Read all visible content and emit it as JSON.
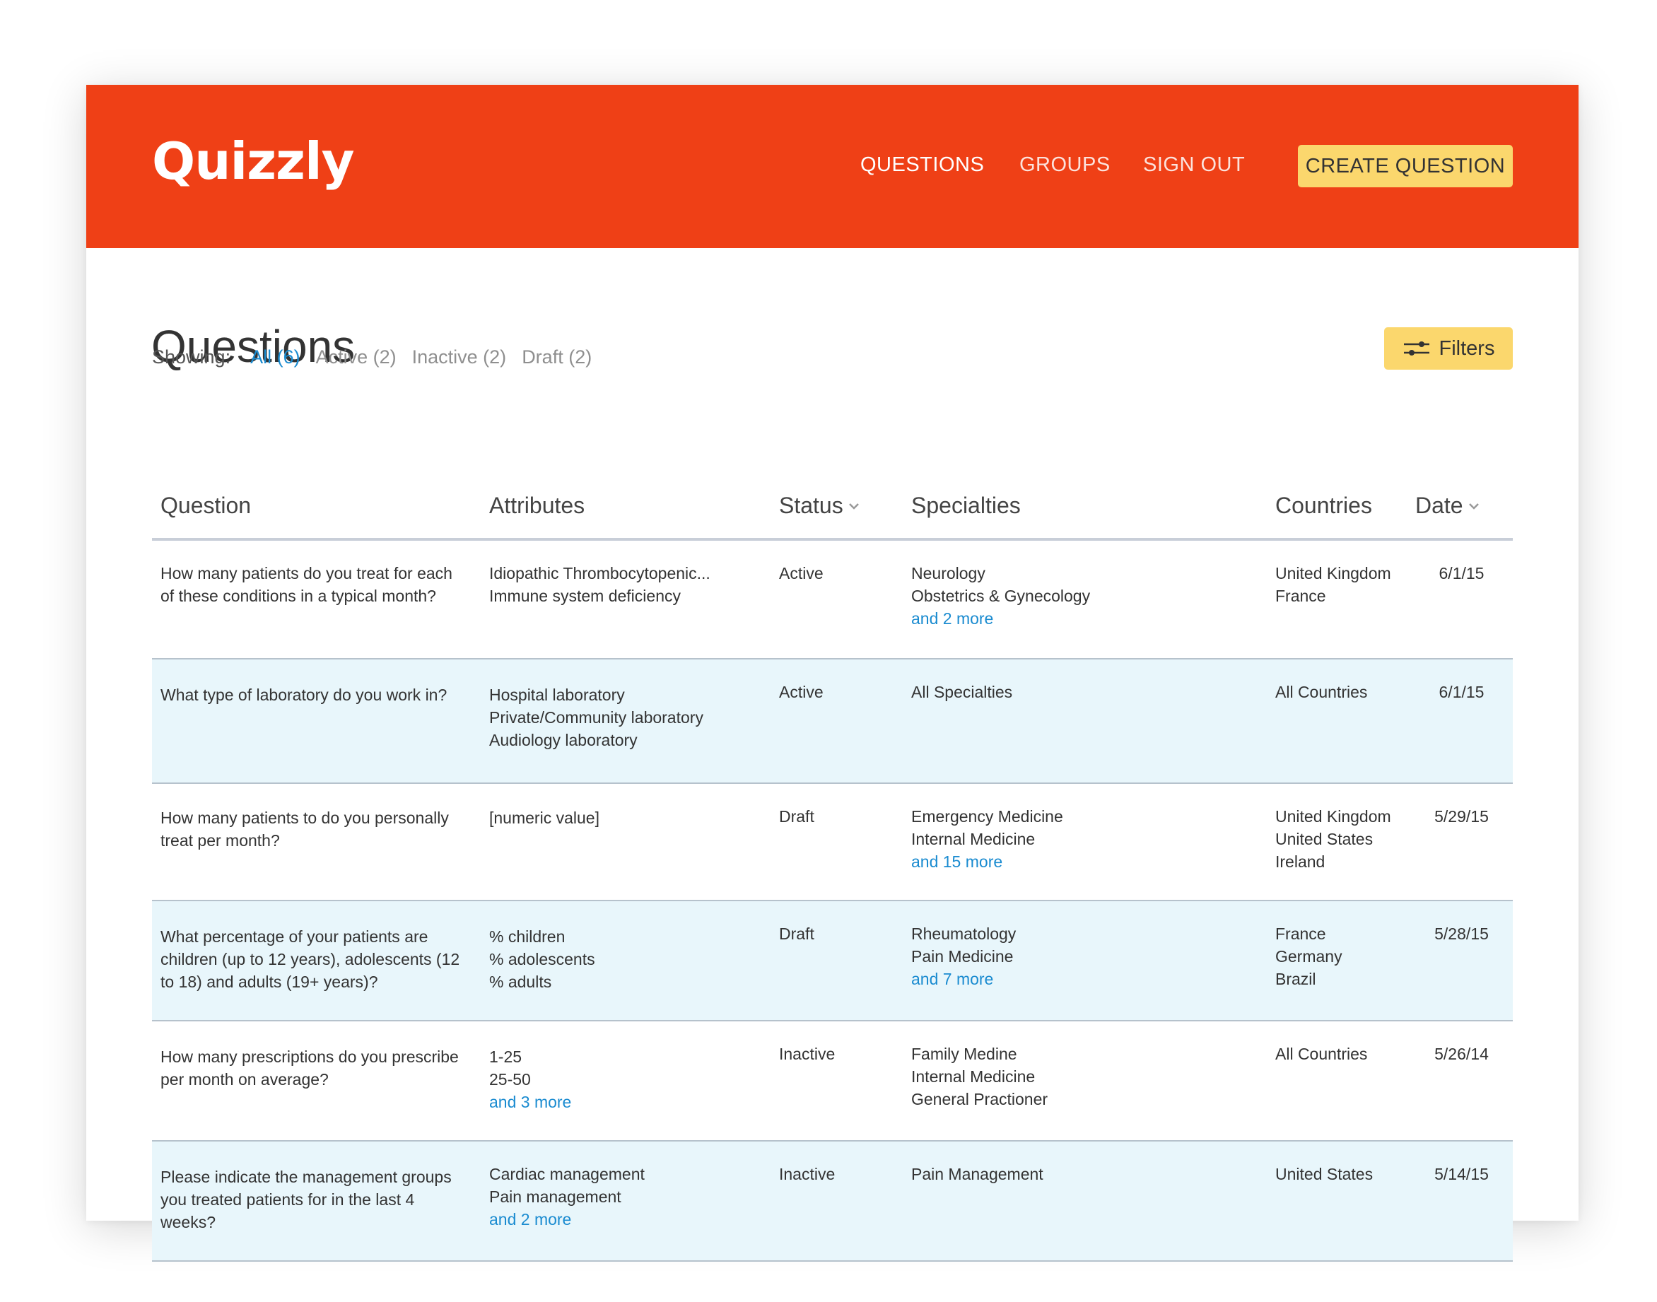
{
  "header": {
    "logo": "Quizzly",
    "nav": {
      "questions": "QUESTIONS",
      "groups": "GROUPS",
      "sign_out": "SIGN OUT"
    },
    "create_button": "CREATE QUESTION"
  },
  "colors": {
    "brand": "#ef4016",
    "accent_button": "#fbd76d",
    "link": "#1a8bd0",
    "alt_row": "#e8f6fb"
  },
  "page": {
    "title": "Questions",
    "showing_label": "Showing:",
    "filters": [
      {
        "label": "All (6)",
        "active": true
      },
      {
        "label": "Active (2)",
        "active": false
      },
      {
        "label": "Inactive (2)",
        "active": false
      },
      {
        "label": "Draft (2)",
        "active": false
      }
    ],
    "filters_button": "Filters",
    "filters_icon": "sliders-icon"
  },
  "table": {
    "headers": {
      "question": "Question",
      "attributes": "Attributes",
      "status": "Status",
      "specialties": "Specialties",
      "countries": "Countries",
      "date": "Date"
    },
    "rows": [
      {
        "question": "How many patients do you treat for each of these conditions in a typical month?",
        "attributes": [
          "Idiopathic Thrombocytopenic...",
          "Immune system deficiency"
        ],
        "attributes_more": "",
        "status": "Active",
        "specialties": [
          "Neurology",
          "Obstetrics & Gynecology"
        ],
        "specialties_more": "and 2 more",
        "countries": [
          "United Kingdom",
          "France"
        ],
        "date": "6/1/15"
      },
      {
        "question": "What type of laboratory do you work in?",
        "attributes": [
          "Hospital laboratory",
          "Private/Community laboratory",
          "Audiology laboratory"
        ],
        "attributes_more": "",
        "status": "Active",
        "specialties": [
          "All Specialties"
        ],
        "specialties_more": "",
        "countries": [
          "All Countries"
        ],
        "date": "6/1/15"
      },
      {
        "question": "How many patients to do you personally treat per month?",
        "attributes": [
          "[numeric value]"
        ],
        "attributes_more": "",
        "status": "Draft",
        "specialties": [
          "Emergency Medicine",
          "Internal Medicine"
        ],
        "specialties_more": "and 15 more",
        "countries": [
          "United Kingdom",
          "United States",
          "Ireland"
        ],
        "date": "5/29/15"
      },
      {
        "question": "What percentage of your patients are children (up to 12 years), adolescents (12 to 18) and adults (19+ years)?",
        "attributes": [
          "% children",
          "% adolescents",
          "% adults"
        ],
        "attributes_more": "",
        "status": "Draft",
        "specialties": [
          "Rheumatology",
          "Pain Medicine"
        ],
        "specialties_more": "and 7 more",
        "countries": [
          "France",
          "Germany",
          "Brazil"
        ],
        "date": "5/28/15"
      },
      {
        "question": "How many prescriptions do you prescribe per month on average?",
        "attributes": [
          "1-25",
          "25-50"
        ],
        "attributes_more": "and 3 more",
        "status": "Inactive",
        "specialties": [
          "Family Medine",
          "Internal Medicine",
          "General Practioner"
        ],
        "specialties_more": "",
        "countries": [
          "All Countries"
        ],
        "date": "5/26/14"
      },
      {
        "question": "Please indicate the management groups you treated patients for in the last 4 weeks?",
        "attributes": [
          "Cardiac management",
          "Pain management"
        ],
        "attributes_more": "and 2 more",
        "status": "Inactive",
        "specialties": [
          "Pain Management"
        ],
        "specialties_more": "",
        "countries": [
          "United States"
        ],
        "date": "5/14/15"
      }
    ]
  }
}
